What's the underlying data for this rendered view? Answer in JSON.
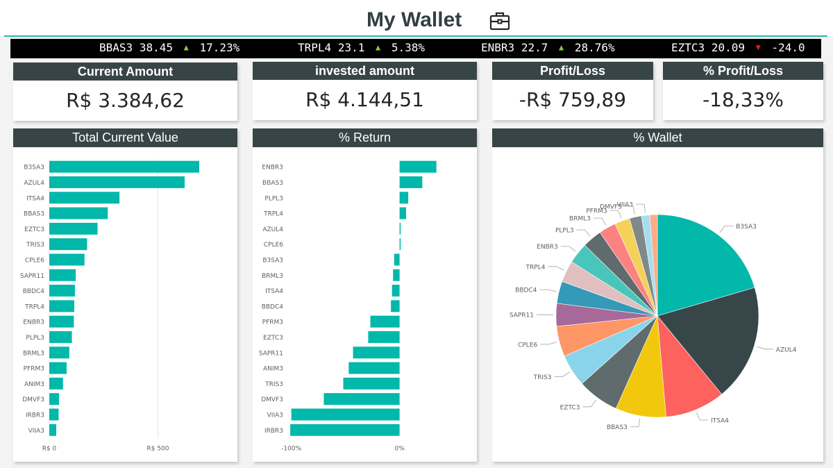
{
  "title": "My Wallet",
  "ticker": [
    {
      "symbol": "BBAS3",
      "price": "38.45",
      "direction": "up",
      "change": "17.23%"
    },
    {
      "symbol": "TRPL4",
      "price": "23.1",
      "direction": "up",
      "change": "5.38%"
    },
    {
      "symbol": "ENBR3",
      "price": "22.7",
      "direction": "up",
      "change": "28.76%"
    },
    {
      "symbol": "EZTC3",
      "price": "20.09",
      "direction": "down",
      "change": "-24.0"
    }
  ],
  "kpis": {
    "current_amount": {
      "label": "Current Amount",
      "value": "R$ 3.384,62"
    },
    "invested_amount": {
      "label": "invested amount",
      "value": "R$ 4.144,51"
    },
    "profit_loss": {
      "label": "Profit/Loss",
      "value": "-R$ 759,89"
    },
    "pct_profit_loss": {
      "label": "% Profit/Loss",
      "value": "-18,33%"
    }
  },
  "colors": {
    "header": "#384547",
    "accent": "#01b8aa",
    "ticker_up": "#8cc63f",
    "ticker_down": "#e21b1b"
  },
  "chart_data": [
    {
      "type": "bar",
      "orientation": "horizontal",
      "title": "Total Current Value",
      "categories": [
        "B3SA3",
        "AZUL4",
        "ITSA4",
        "BBAS3",
        "EZTC3",
        "TRIS3",
        "CPLE6",
        "SAPR11",
        "BBDC4",
        "TRPL4",
        "ENBR3",
        "PLPL3",
        "BRML3",
        "PFRM3",
        "ANIM3",
        "DMVF3",
        "IRBR3",
        "VIIA3"
      ],
      "values": [
        690,
        623,
        323,
        269,
        222,
        174,
        162,
        122,
        118,
        115,
        113,
        104,
        92,
        80,
        63,
        45,
        43,
        32
      ],
      "xlim": [
        0,
        690
      ],
      "ticks": [
        {
          "value": 0,
          "label": "R$ 0"
        },
        {
          "value": 500,
          "label": "R$ 500"
        }
      ],
      "grid": true,
      "color": "#01b8aa"
    },
    {
      "type": "bar",
      "orientation": "horizontal",
      "title": "% Return",
      "categories": [
        "ENBR3",
        "BBAS3",
        "PLPL3",
        "TRPL4",
        "AZUL4",
        "CPLE6",
        "B3SA3",
        "BRML3",
        "ITSA4",
        "BBDC4",
        "PFRM3",
        "EZTC3",
        "SAPR11",
        "ANIM3",
        "TRIS3",
        "DMVF3",
        "VIIA3",
        "IRBR3"
      ],
      "values": [
        34,
        21,
        8,
        6,
        1,
        1,
        -5,
        -6,
        -7,
        -8,
        -27,
        -29,
        -43,
        -47,
        -52,
        -70,
        -100,
        -101
      ],
      "xlim": [
        -103,
        40
      ],
      "ticks": [
        {
          "value": -100,
          "label": "-100%"
        },
        {
          "value": 0,
          "label": "0%"
        }
      ],
      "color": "#01b8aa"
    },
    {
      "type": "pie",
      "title": "% Wallet",
      "labels": [
        "B3SA3",
        "AZUL4",
        "ITSA4",
        "BBAS3",
        "EZTC3",
        "TRIS3",
        "CPLE6",
        "SAPR11",
        "BBDC4",
        "TRPL4",
        "ENBR3",
        "PLPL3",
        "BRML3",
        "PFRM3",
        "DMVF3",
        "VIIA3",
        "IRBR3"
      ],
      "values": [
        20.3,
        18.4,
        9.5,
        8.0,
        6.6,
        5.1,
        4.8,
        3.6,
        3.5,
        3.4,
        3.3,
        3.1,
        2.7,
        2.4,
        1.9,
        1.3,
        1.2
      ],
      "colors": [
        "#01b8aa",
        "#374649",
        "#fd625e",
        "#f2c80f",
        "#5f6b6d",
        "#8ad4eb",
        "#fe9666",
        "#a66999",
        "#3599b8",
        "#dfbfbf",
        "#4ac5bb",
        "#5f6b6d",
        "#fb8281",
        "#f4d25a",
        "#7f898a",
        "#a4ddee",
        "#fdab89"
      ],
      "labeled": [
        "B3SA3",
        "AZUL4",
        "ITSA4",
        "BBAS3",
        "EZTC3",
        "TRIS3",
        "CPLE6",
        "SAPR11",
        "BBDC4",
        "TRPL4",
        "ENBR3",
        "PLPL3",
        "BRML3",
        "PFRM3",
        "DMVF3",
        "VIIA3"
      ]
    }
  ]
}
